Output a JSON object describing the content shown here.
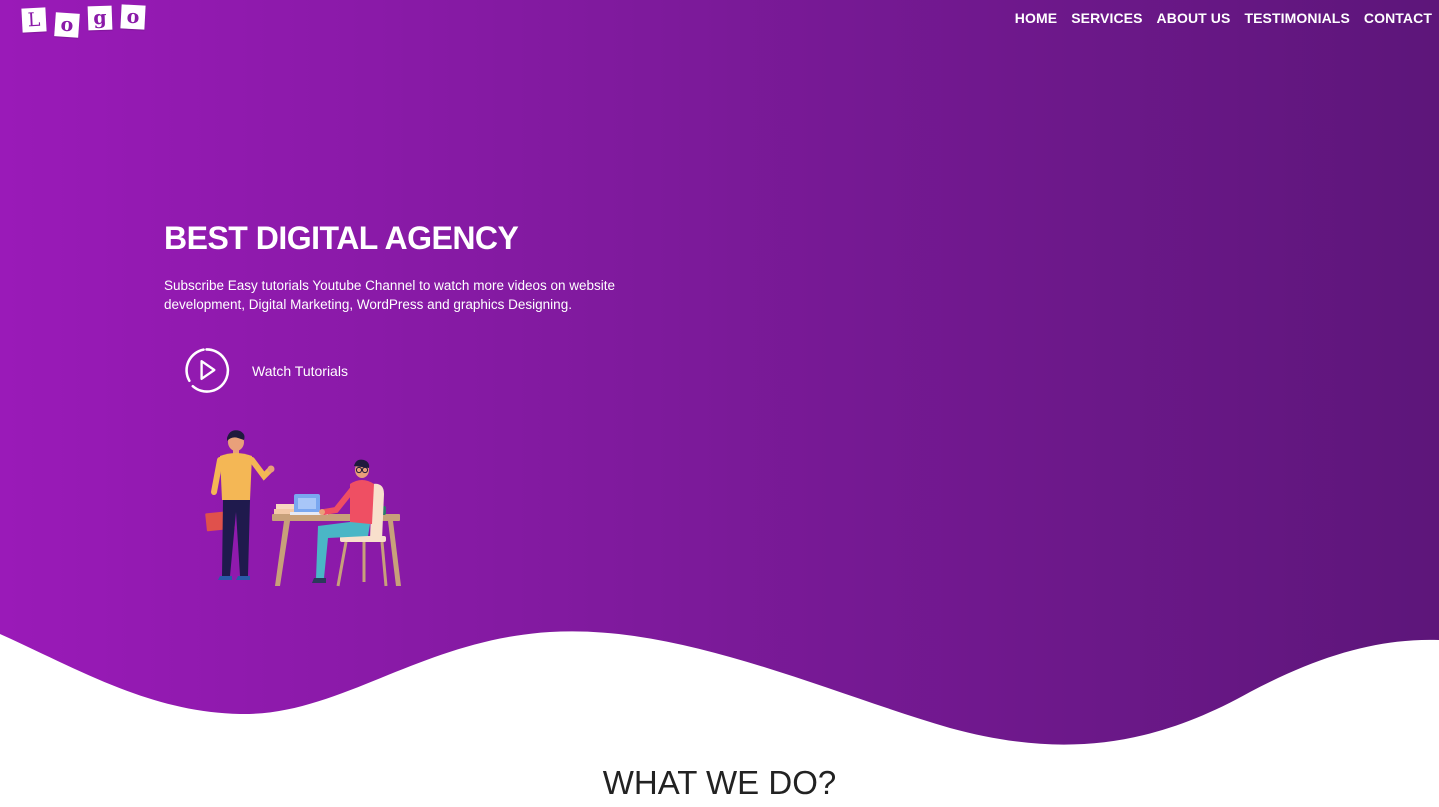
{
  "logo": {
    "letters": [
      "L",
      "o",
      "g",
      "o"
    ]
  },
  "nav": {
    "items": [
      {
        "label": "HOME"
      },
      {
        "label": "SERVICES"
      },
      {
        "label": "ABOUT US"
      },
      {
        "label": "TESTIMONIALS"
      },
      {
        "label": "CONTACT"
      }
    ]
  },
  "hero": {
    "title": "BEST DIGITAL AGENCY",
    "description": "Subscribe Easy tutorials Youtube Channel to watch more videos on website development, Digital Marketing, WordPress and graphics Designing.",
    "cta": {
      "label": "Watch Tutorials",
      "icon": "play-circle-icon"
    },
    "illustration": "two-people-office-illustration"
  },
  "colors": {
    "gradient_start": "#9a1ab8",
    "gradient_end": "#5d167a",
    "text": "#ffffff",
    "section_title": "#222222"
  },
  "section": {
    "title": "WHAT WE DO?"
  }
}
